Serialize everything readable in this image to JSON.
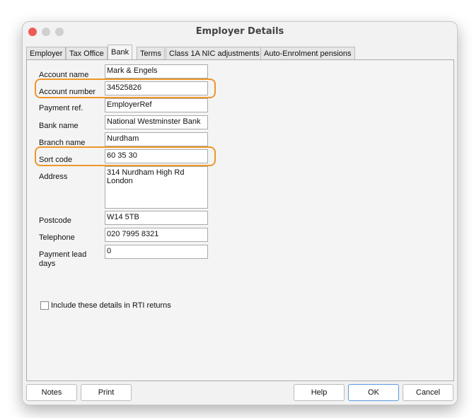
{
  "window": {
    "title": "Employer Details"
  },
  "tabs": [
    "Employer",
    "Tax Office",
    "Bank",
    "Terms",
    "Class 1A NIC adjustments",
    "Auto-Enrolment pensions"
  ],
  "active_tab": "Bank",
  "fields": {
    "account_name": {
      "label": "Account name",
      "value": "Mark & Engels"
    },
    "account_number": {
      "label": "Account number",
      "value": "34525826"
    },
    "payment_ref": {
      "label": "Payment ref.",
      "value": "EmployerRef"
    },
    "bank_name": {
      "label": "Bank name",
      "value": "National Westminster Bank"
    },
    "branch_name": {
      "label": "Branch name",
      "value": "Nurdham"
    },
    "sort_code": {
      "label": "Sort code",
      "value": "60 35 30"
    },
    "address": {
      "label": "Address",
      "value": "314 Nurdham High Rd\nLondon"
    },
    "postcode": {
      "label": "Postcode",
      "value": "W14 5TB"
    },
    "telephone": {
      "label": "Telephone",
      "value": "020 7995 8321"
    },
    "payment_lead_days": {
      "label": "Payment lead days",
      "value": "0"
    }
  },
  "rti_checkbox": {
    "label": "Include these details in RTI returns",
    "checked": false
  },
  "buttons": {
    "notes": "Notes",
    "print": "Print",
    "help": "Help",
    "ok": "OK",
    "cancel": "Cancel"
  },
  "colors": {
    "highlight": "#f0962a",
    "close": "#ee5a52"
  }
}
